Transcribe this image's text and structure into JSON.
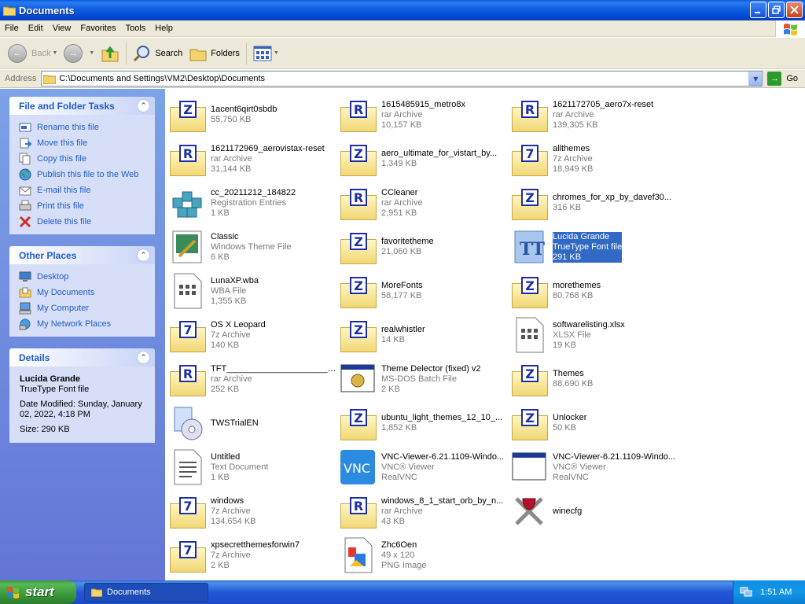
{
  "window": {
    "title": "Documents"
  },
  "menu": [
    "File",
    "Edit",
    "View",
    "Favorites",
    "Tools",
    "Help"
  ],
  "toolbar": {
    "back": "Back",
    "search": "Search",
    "folders": "Folders"
  },
  "address": {
    "label": "Address",
    "path": "C:\\Documents and Settings\\VM2\\Desktop\\Documents",
    "go": "Go"
  },
  "tasks": {
    "title": "File and Folder Tasks",
    "items": [
      "Rename this file",
      "Move this file",
      "Copy this file",
      "Publish this file to the Web",
      "E-mail this file",
      "Print this file",
      "Delete this file"
    ]
  },
  "places": {
    "title": "Other Places",
    "items": [
      "Desktop",
      "My Documents",
      "My Computer",
      "My Network Places"
    ]
  },
  "details": {
    "title": "Details",
    "name": "Lucida Grande",
    "type": "TrueType Font file",
    "modified": "Date Modified: Sunday, January 02, 2022, 4:18 PM",
    "size": "Size: 290 KB"
  },
  "files": [
    {
      "name": "1acent6qirt0sbdb",
      "type": "",
      "size": "55,750 KB",
      "icon": "archive-z"
    },
    {
      "name": "1615485915_metro8x",
      "type": "rar Archive",
      "size": "10,157 KB",
      "icon": "archive-r"
    },
    {
      "name": "1621172705_aero7x-reset",
      "type": "rar Archive",
      "size": "139,305 KB",
      "icon": "archive-r"
    },
    {
      "name": "1621172969_aerovistax-reset",
      "type": "rar Archive",
      "size": "31,144 KB",
      "icon": "archive-r"
    },
    {
      "name": "aero_ultimate_for_vistart_by...",
      "type": "",
      "size": "1,349 KB",
      "icon": "archive-z"
    },
    {
      "name": "allthemes",
      "type": "7z Archive",
      "size": "18,949 KB",
      "icon": "archive-7"
    },
    {
      "name": "cc_20211212_184822",
      "type": "Registration Entries",
      "size": "1 KB",
      "icon": "registry"
    },
    {
      "name": "CCleaner",
      "type": "rar Archive",
      "size": "2,951 KB",
      "icon": "archive-r"
    },
    {
      "name": "chromes_for_xp_by_davef30...",
      "type": "",
      "size": "316 KB",
      "icon": "archive-z"
    },
    {
      "name": "Classic",
      "type": "Windows Theme File",
      "size": "6 KB",
      "icon": "theme"
    },
    {
      "name": "favoritetheme",
      "type": "",
      "size": "21,060 KB",
      "icon": "archive-z"
    },
    {
      "name": "Lucida Grande",
      "type": "TrueType Font file",
      "size": "291 KB",
      "icon": "font",
      "selected": true
    },
    {
      "name": "LunaXP.wba",
      "type": "WBA File",
      "size": "1,355 KB",
      "icon": "doc-grid"
    },
    {
      "name": "MoreFonts",
      "type": "",
      "size": "58,177 KB",
      "icon": "archive-z"
    },
    {
      "name": "morethemes",
      "type": "",
      "size": "80,768 KB",
      "icon": "archive-z"
    },
    {
      "name": "OS X Leopard",
      "type": "7z Archive",
      "size": "140 KB",
      "icon": "archive-7"
    },
    {
      "name": "realwhistler",
      "type": "",
      "size": "14 KB",
      "icon": "archive-z"
    },
    {
      "name": "softwarelisting.xlsx",
      "type": "XLSX File",
      "size": "19 KB",
      "icon": "doc-grid"
    },
    {
      "name": "TFT__________________________",
      "type": "rar Archive",
      "size": "252 KB",
      "icon": "archive-r"
    },
    {
      "name": "Theme Delector (fixed) v2",
      "type": "MS-DOS Batch File",
      "size": "2 KB",
      "icon": "batch"
    },
    {
      "name": "Themes",
      "type": "",
      "size": "88,690 KB",
      "icon": "archive-z"
    },
    {
      "name": "TWSTrialEN",
      "type": "",
      "size": "",
      "icon": "installer"
    },
    {
      "name": "ubuntu_light_themes_12_10_...",
      "type": "",
      "size": "1,852 KB",
      "icon": "archive-z"
    },
    {
      "name": "Unlocker",
      "type": "",
      "size": "50 KB",
      "icon": "archive-z"
    },
    {
      "name": "Untitled",
      "type": "Text Document",
      "size": "1 KB",
      "icon": "textdoc"
    },
    {
      "name": "VNC-Viewer-6.21.1109-Windo...",
      "type": "VNC® Viewer",
      "size": "RealVNC",
      "icon": "vnc"
    },
    {
      "name": "VNC-Viewer-6.21.1109-Windo...",
      "type": "VNC® Viewer",
      "size": "RealVNC",
      "icon": "window"
    },
    {
      "name": "windows",
      "type": "7z Archive",
      "size": "134,654 KB",
      "icon": "archive-7"
    },
    {
      "name": "windows_8_1_start_orb_by_n...",
      "type": "rar Archive",
      "size": "43 KB",
      "icon": "archive-r"
    },
    {
      "name": "winecfg",
      "type": "",
      "size": "",
      "icon": "wine"
    },
    {
      "name": "xpsecretthemesforwin7",
      "type": "7z Archive",
      "size": "2 KB",
      "icon": "archive-7"
    },
    {
      "name": "Zhc6Oen",
      "type": "49 x 120",
      "size": "PNG Image",
      "icon": "image"
    }
  ],
  "taskbar": {
    "start": "start",
    "task": "Documents",
    "clock": "1:51 AM"
  },
  "colors": {
    "selection": "#316ac5",
    "link": "#215dc6",
    "titlebar": "#0046cf",
    "start": "#3a9a3a"
  }
}
